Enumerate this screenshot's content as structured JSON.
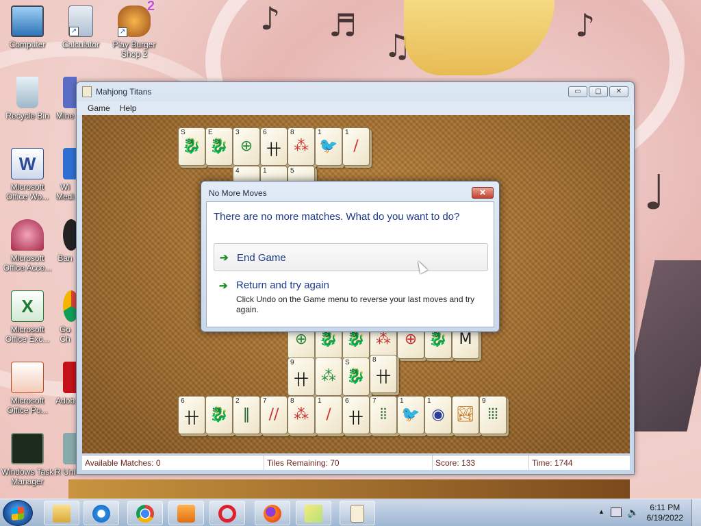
{
  "desktop": {
    "icons": [
      {
        "label": "Computer",
        "icon": "computer-icon"
      },
      {
        "label": "Calculator",
        "icon": "calculator-icon"
      },
      {
        "label": "Play Burger Shop 2",
        "icon": "burger-shop-icon",
        "badge": "2"
      },
      {
        "label": "Recycle Bin",
        "icon": "recycle-bin-icon"
      },
      {
        "label": "Mine",
        "icon": "minesweeper-icon"
      },
      {
        "label": "Microsoft Office Wo...",
        "icon": "word-icon",
        "glyph": "W"
      },
      {
        "label": "Wi Medi",
        "icon": "media-player-icon"
      },
      {
        "label": "Microsoft Office Acce...",
        "icon": "access-icon"
      },
      {
        "label": "Ban",
        "icon": "bandicam-icon"
      },
      {
        "label": "Microsoft Office Exc...",
        "icon": "excel-icon",
        "glyph": "X"
      },
      {
        "label": "Go Ch",
        "icon": "google-chrome-icon"
      },
      {
        "label": "Microsoft Office Po...",
        "icon": "powerpoint-icon"
      },
      {
        "label": "Adob",
        "icon": "adobe-icon"
      },
      {
        "label": "Windows Task Manager",
        "icon": "task-manager-icon"
      },
      {
        "label": "R Uni",
        "icon": "uninstaller-icon"
      }
    ]
  },
  "window": {
    "title": "Mahjong Titans",
    "menu": [
      "Game",
      "Help"
    ],
    "controls": {
      "minimize": "▭",
      "maximize": "▢",
      "close": "✕"
    }
  },
  "status": {
    "available_matches": "Available Matches: 0",
    "tiles_remaining": "Tiles Remaining: 70",
    "score": "Score: 133",
    "time": "Time: 1744"
  },
  "dialog": {
    "title": "No More Moves",
    "question": "There are no more matches. What do you want to do?",
    "close": "✕",
    "option_end": {
      "arrow": "➔",
      "label": "End Game"
    },
    "option_retry": {
      "arrow": "➔",
      "label": "Return and try again",
      "description": "Click Undo on the Game menu to reverse your last moves and try again."
    }
  },
  "tiles": {
    "top_row": [
      {
        "n": "S",
        "sym": "🐉"
      },
      {
        "n": "E",
        "sym": "🐉"
      },
      {
        "n": "3",
        "sym": "⊕"
      },
      {
        "n": "6",
        "sym": "卄"
      },
      {
        "n": "8",
        "sym": "⁂"
      },
      {
        "n": "1",
        "sym": "🐦"
      },
      {
        "n": "1",
        "sym": "/"
      }
    ],
    "under_top": [
      {
        "n": "4",
        "sym": ""
      },
      {
        "n": "1",
        "sym": ""
      },
      {
        "n": "5",
        "sym": ""
      }
    ],
    "mid_row": [
      {
        "n": "",
        "sym": "⊕"
      },
      {
        "n": "",
        "sym": "🐉"
      },
      {
        "n": "",
        "sym": "🐉"
      },
      {
        "n": "",
        "sym": "⁂"
      },
      {
        "n": "",
        "sym": "⊕"
      },
      {
        "n": "",
        "sym": "🐉"
      },
      {
        "n": "8",
        "sym": "M"
      }
    ],
    "low_row": [
      {
        "n": "9",
        "sym": "卄"
      },
      {
        "n": "",
        "sym": "⁂"
      },
      {
        "n": "S",
        "sym": "🐉"
      },
      {
        "n": "8",
        "sym": "卄"
      }
    ],
    "bottom_row": [
      {
        "n": "6",
        "sym": "卄"
      },
      {
        "n": "",
        "sym": "🐉"
      },
      {
        "n": "2",
        "sym": "∥"
      },
      {
        "n": "7",
        "sym": "//"
      },
      {
        "n": "8",
        "sym": "⁂"
      },
      {
        "n": "1",
        "sym": "/"
      },
      {
        "n": "6",
        "sym": "卄"
      },
      {
        "n": "7",
        "sym": "⦙⦙"
      },
      {
        "n": "1",
        "sym": "🐦"
      },
      {
        "n": "1",
        "sym": "◉"
      },
      {
        "n": "",
        "sym": "🏞"
      },
      {
        "n": "9",
        "sym": "⦙⦙⦙"
      }
    ]
  },
  "taskbar": {
    "apps": [
      {
        "name": "file-explorer",
        "icon": "folder-icon"
      },
      {
        "name": "internet-explorer",
        "icon": "ie-icon"
      },
      {
        "name": "chrome",
        "icon": "chrome-icon"
      },
      {
        "name": "media-player",
        "icon": "media-icon"
      },
      {
        "name": "opera",
        "icon": "opera-icon"
      },
      {
        "name": "firefox",
        "icon": "firefox-icon"
      },
      {
        "name": "sticky-notes",
        "icon": "sticky-notes-icon"
      },
      {
        "name": "mahjong-titans",
        "icon": "mahjong-icon"
      }
    ],
    "time": "6:11 PM",
    "date": "6/19/2022",
    "tray_arrow": "▲"
  },
  "colors": {
    "dialog_text": "#1b3a8a",
    "arrow_green": "#1e8c2a",
    "status_text": "#6b1f18",
    "board_brown": "#a87030"
  }
}
